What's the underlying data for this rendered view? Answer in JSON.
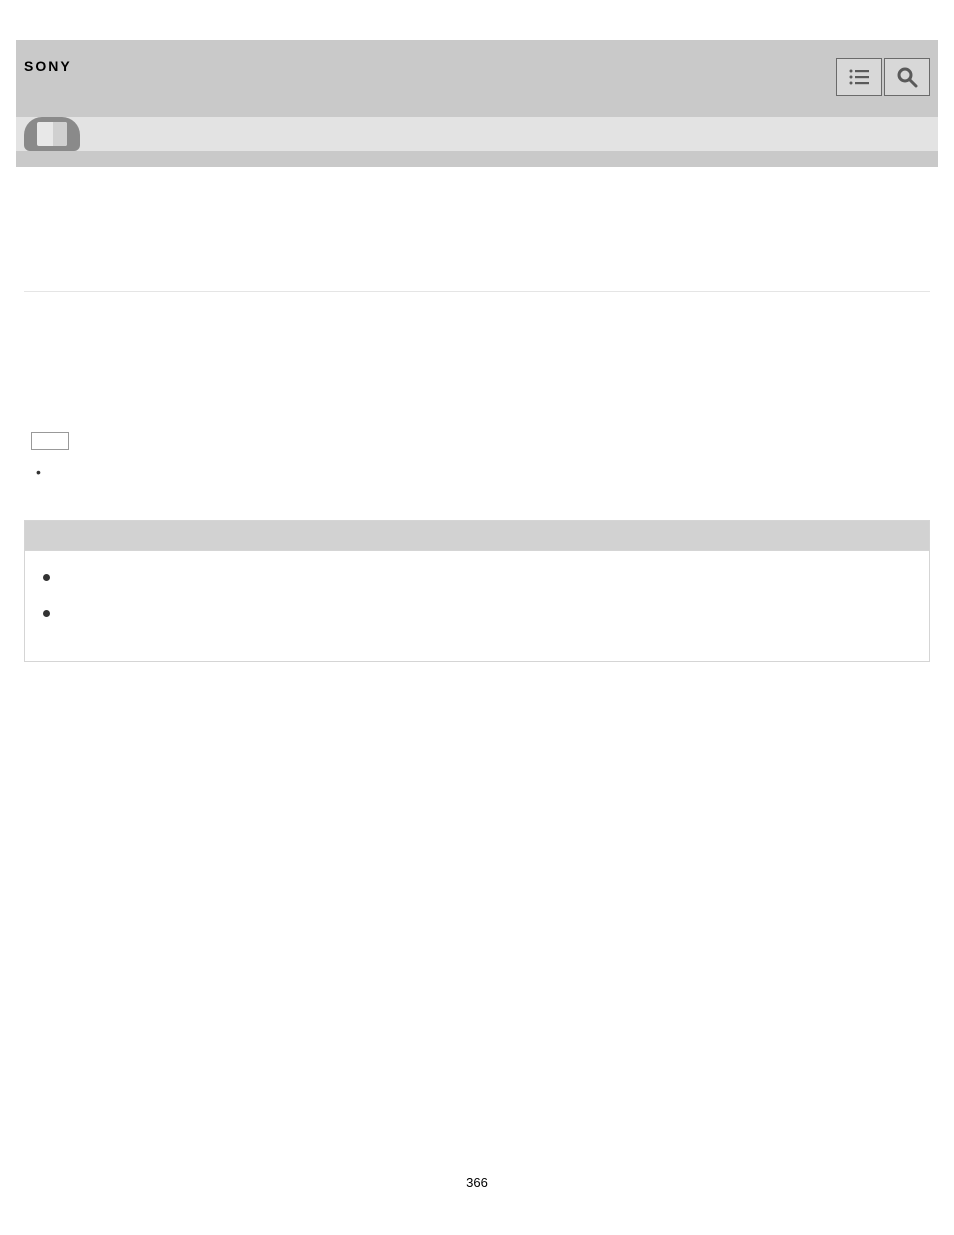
{
  "header": {
    "brand": "SONY"
  },
  "page": {
    "number": "366"
  },
  "content": {
    "list_item_1": "",
    "box_header": "",
    "box_bullet_1": "",
    "box_bullet_2": ""
  }
}
